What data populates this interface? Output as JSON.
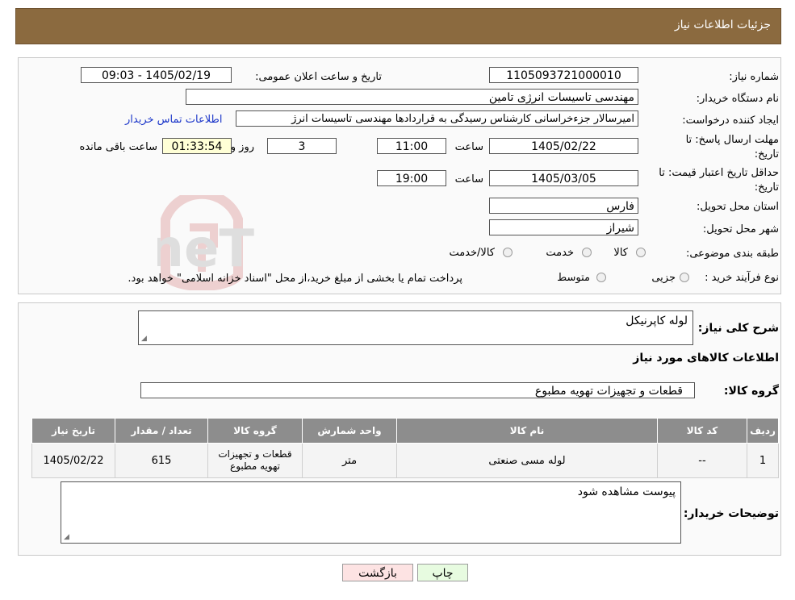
{
  "header": {
    "title": "جزئیات اطلاعات نیاز"
  },
  "form": {
    "need_number_label": "شماره نیاز:",
    "need_number": "1105093721000010",
    "announce_label": "تاریخ و ساعت اعلان عمومی:",
    "announce_value": "1405/02/19 - 09:03",
    "buyer_org_label": "نام دستگاه خریدار:",
    "buyer_org": "مهندسی تاسیسات انرژی تامین",
    "creator_label": "ایجاد کننده درخواست:",
    "creator": "امیرسالار جزءخراسانی کارشناس رسیدگی به قراردادها مهندسی تاسیسات انرژ",
    "contact_link": "اطلاعات تماس خریدار",
    "deadline_label_1": "مهلت ارسال پاسخ: تا",
    "deadline_label_2": "تاریخ:",
    "deadline_date": "1405/02/22",
    "time_label": "ساعت",
    "deadline_time": "11:00",
    "days_value": "3",
    "days_label": "روز و",
    "remaining_value": "01:33:54",
    "remaining_label": "ساعت باقی مانده",
    "validity_label_1": "حداقل تاریخ اعتبار قیمت: تا",
    "validity_label_2": "تاریخ:",
    "validity_date": "1405/03/05",
    "validity_time_label": "ساعت",
    "validity_time": "19:00",
    "province_label": "استان محل تحویل:",
    "province": "فارس",
    "city_label": "شهر محل تحویل:",
    "city": "شیراز",
    "category_label": "طبقه بندی موضوعی:",
    "category_options": [
      "کالا",
      "خدمت",
      "کالا/خدمت"
    ],
    "process_label": "نوع فرآیند خرید :",
    "process_options": [
      "جزیی",
      "متوسط"
    ],
    "process_note": "پرداخت تمام یا بخشی از مبلغ خرید،از محل \"اسناد خزانه اسلامی\" خواهد بود."
  },
  "summary": {
    "desc_label": "شرح کلی نیاز:",
    "desc_value": "لوله کاپرنیکل",
    "items_title": "اطلاعات کالاهای مورد نیاز",
    "group_label": "گروه کالا:",
    "group_value": "قطعات و تجهیزات تهویه مطبوع"
  },
  "table": {
    "headers": [
      "ردیف",
      "کد کالا",
      "نام کالا",
      "واحد شمارش",
      "گروه کالا",
      "تعداد / مقدار",
      "تاریخ نیاز"
    ],
    "rows": [
      [
        "1",
        "--",
        "لوله مسی صنعتی",
        "متر",
        "قطعات و تجهیزات تهویه مطبوع",
        "615",
        "1405/02/22"
      ]
    ]
  },
  "notes": {
    "label": "توضیحات خریدار:",
    "value": "پیوست مشاهده شود"
  },
  "buttons": {
    "print": "چاپ",
    "back": "بازگشت"
  },
  "watermark": {
    "text": "AriaTender.neT"
  },
  "colors": {
    "header": "#8b6a3f",
    "table_header": "#8d8d8d",
    "link": "#1a35c9",
    "back_button": "#fde3e3",
    "print_button": "#e7fbe0"
  }
}
